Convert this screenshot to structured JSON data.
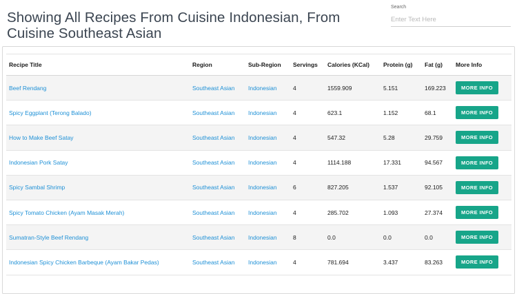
{
  "header": {
    "title": "Showing All Recipes From Cuisine Indonesian, From Cuisine Southeast Asian"
  },
  "search": {
    "label": "Search",
    "placeholder": "Enter Text Here",
    "value": ""
  },
  "table": {
    "columns": [
      "Recipe Title",
      "Region",
      "Sub-Region",
      "Servings",
      "Calories (KCal)",
      "Protein (g)",
      "Fat (g)",
      "More Info"
    ],
    "button_label": "MORE INFO",
    "rows": [
      {
        "title": "Beef Rendang",
        "region": "Southeast Asian",
        "subregion": "Indonesian",
        "servings": "4",
        "calories": "1559.909",
        "protein": "5.151",
        "fat": "169.223"
      },
      {
        "title": "Spicy Eggplant (Terong Balado)",
        "region": "Southeast Asian",
        "subregion": "Indonesian",
        "servings": "4",
        "calories": "623.1",
        "protein": "1.152",
        "fat": "68.1"
      },
      {
        "title": "How to Make Beef Satay",
        "region": "Southeast Asian",
        "subregion": "Indonesian",
        "servings": "4",
        "calories": "547.32",
        "protein": "5.28",
        "fat": "29.759"
      },
      {
        "title": "Indonesian Pork Satay",
        "region": "Southeast Asian",
        "subregion": "Indonesian",
        "servings": "4",
        "calories": "1114.188",
        "protein": "17.331",
        "fat": "94.567"
      },
      {
        "title": "Spicy Sambal Shrimp",
        "region": "Southeast Asian",
        "subregion": "Indonesian",
        "servings": "6",
        "calories": "827.205",
        "protein": "1.537",
        "fat": "92.105"
      },
      {
        "title": "Spicy Tomato Chicken (Ayam Masak Merah)",
        "region": "Southeast Asian",
        "subregion": "Indonesian",
        "servings": "4",
        "calories": "285.702",
        "protein": "1.093",
        "fat": "27.374"
      },
      {
        "title": "Sumatran-Style Beef Rendang",
        "region": "Southeast Asian",
        "subregion": "Indonesian",
        "servings": "8",
        "calories": "0.0",
        "protein": "0.0",
        "fat": "0.0"
      },
      {
        "title": "Indonesian Spicy Chicken Barbeque (Ayam Bakar Pedas)",
        "region": "Southeast Asian",
        "subregion": "Indonesian",
        "servings": "4",
        "calories": "781.694",
        "protein": "3.437",
        "fat": "83.263"
      }
    ]
  },
  "colors": {
    "link": "#1e90d6",
    "button": "#17a589",
    "title": "#3b4551"
  }
}
